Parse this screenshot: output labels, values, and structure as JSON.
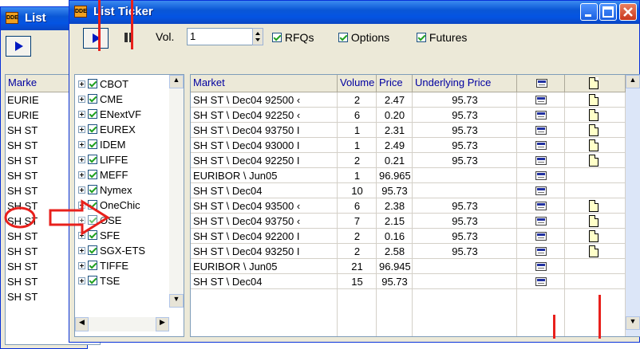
{
  "back_window": {
    "title": "List",
    "header": "Marke",
    "rows": [
      "EURIE",
      "EURIE",
      "SH ST",
      "SH ST",
      "SH ST",
      "SH ST",
      "SH ST",
      "SH ST",
      "SH ST",
      "SH ST",
      "SH ST",
      "SH ST",
      "SH ST",
      "SH ST"
    ]
  },
  "window": {
    "title": "List Ticker",
    "vol_label": "Vol.",
    "vol_value": "1",
    "filters": [
      "RFQs",
      "Options",
      "Futures"
    ]
  },
  "tree": {
    "items": [
      "CBOT",
      "CME",
      "ENextVF",
      "EUREX",
      "IDEM",
      "LIFFE",
      "MEFF",
      "Nymex",
      "OneChic",
      "OSE",
      "SFE",
      "SGX-ETS",
      "TIFFE",
      "TSE"
    ]
  },
  "grid": {
    "columns": [
      "Market",
      "Volume",
      "Price",
      "Underlying Price"
    ],
    "rows": [
      {
        "market": "SH ST \\ Dec04 92500 ‹",
        "volume": "2",
        "price": "2.47",
        "underlying": "95.73",
        "card": true,
        "doc": true
      },
      {
        "market": "SH ST \\ Dec04 92250 ‹",
        "volume": "6",
        "price": "0.20",
        "underlying": "95.73",
        "card": true,
        "doc": true
      },
      {
        "market": "SH ST \\ Dec04 93750 I",
        "volume": "1",
        "price": "2.31",
        "underlying": "95.73",
        "card": true,
        "doc": true
      },
      {
        "market": "SH ST \\ Dec04 93000 I",
        "volume": "1",
        "price": "2.49",
        "underlying": "95.73",
        "card": true,
        "doc": true
      },
      {
        "market": "SH ST \\ Dec04 92250 I",
        "volume": "2",
        "price": "0.21",
        "underlying": "95.73",
        "card": true,
        "doc": true
      },
      {
        "market": "EURIBOR \\ Jun05",
        "volume": "1",
        "price": "96.965",
        "underlying": "",
        "card": true,
        "doc": false
      },
      {
        "market": "SH ST \\ Dec04",
        "volume": "10",
        "price": "95.73",
        "underlying": "",
        "card": true,
        "doc": false
      },
      {
        "market": "SH ST \\ Dec04 93500 ‹",
        "volume": "6",
        "price": "2.38",
        "underlying": "95.73",
        "card": true,
        "doc": true
      },
      {
        "market": "SH ST \\ Dec04 93750 ‹",
        "volume": "7",
        "price": "2.15",
        "underlying": "95.73",
        "card": true,
        "doc": true
      },
      {
        "market": "SH ST \\ Dec04 92200 I",
        "volume": "2",
        "price": "0.16",
        "underlying": "95.73",
        "card": true,
        "doc": true
      },
      {
        "market": "SH ST \\ Dec04 93250 I",
        "volume": "2",
        "price": "2.58",
        "underlying": "95.73",
        "card": true,
        "doc": true
      },
      {
        "market": "EURIBOR \\ Jun05",
        "volume": "21",
        "price": "96.945",
        "underlying": "",
        "card": true,
        "doc": false
      },
      {
        "market": "SH ST \\ Dec04",
        "volume": "15",
        "price": "95.73",
        "underlying": "",
        "card": true,
        "doc": false
      }
    ]
  },
  "icons": {
    "play": "play-icon",
    "pause": "pause-icon",
    "card": "market-card-icon",
    "doc": "document-icon"
  },
  "colors": {
    "titlebar": "#0a57d6",
    "annotation": "#e8201c",
    "header_text": "#0000a0"
  }
}
